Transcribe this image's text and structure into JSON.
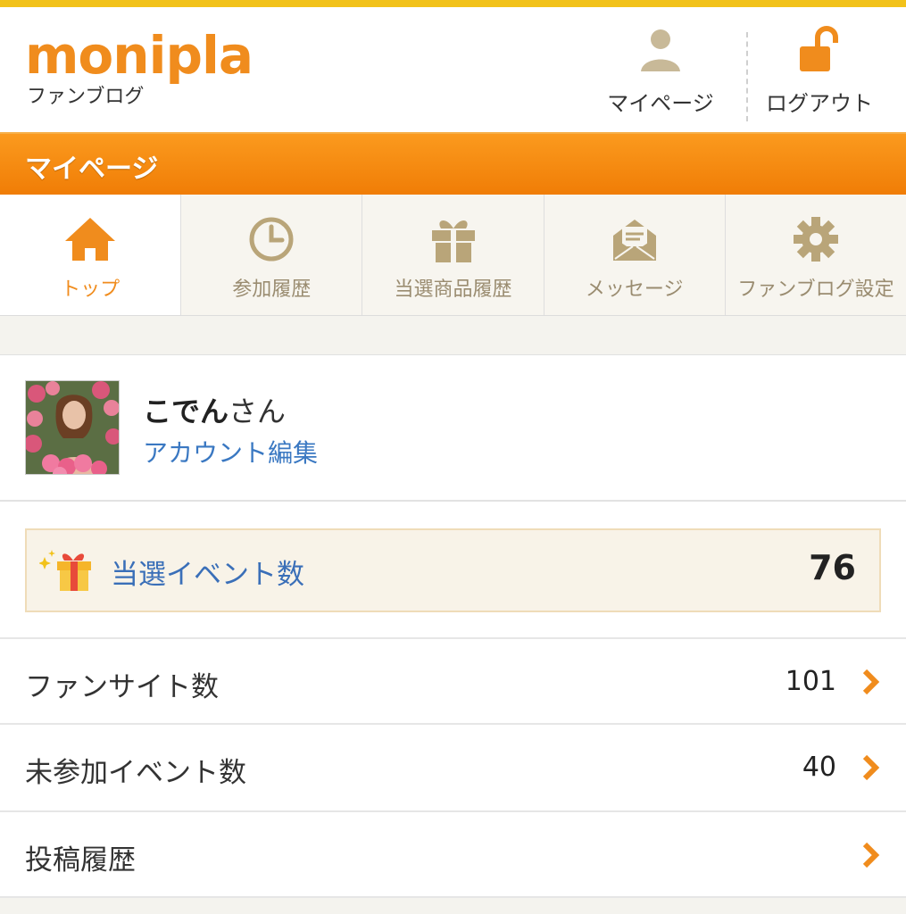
{
  "header": {
    "logo": "monipla",
    "logo_sub": "ファンブログ",
    "mypage_label": "マイページ",
    "logout_label": "ログアウト"
  },
  "section_title": "マイページ",
  "tabs": [
    {
      "label": "トップ",
      "icon": "home-icon",
      "active": true
    },
    {
      "label": "参加履歴",
      "icon": "clock-icon",
      "active": false
    },
    {
      "label": "当選商品履歴",
      "icon": "gift-icon",
      "active": false
    },
    {
      "label": "メッセージ",
      "icon": "envelope-icon",
      "active": false
    },
    {
      "label": "ファンブログ設定",
      "icon": "gear-icon",
      "active": false
    }
  ],
  "profile": {
    "name": "こでん",
    "suffix": "さん",
    "edit_link": "アカウント編集"
  },
  "win_events": {
    "label": "当選イベント数",
    "count": "76"
  },
  "stats": [
    {
      "label": "ファンサイト数",
      "value": "101"
    },
    {
      "label": "未参加イベント数",
      "value": "40"
    },
    {
      "label": "投稿履歴",
      "value": ""
    }
  ],
  "colors": {
    "brand_orange": "#f08c1d",
    "link_blue": "#3a78c2",
    "tab_icon_tan": "#b9a579",
    "top_accent": "#f2c21a"
  }
}
